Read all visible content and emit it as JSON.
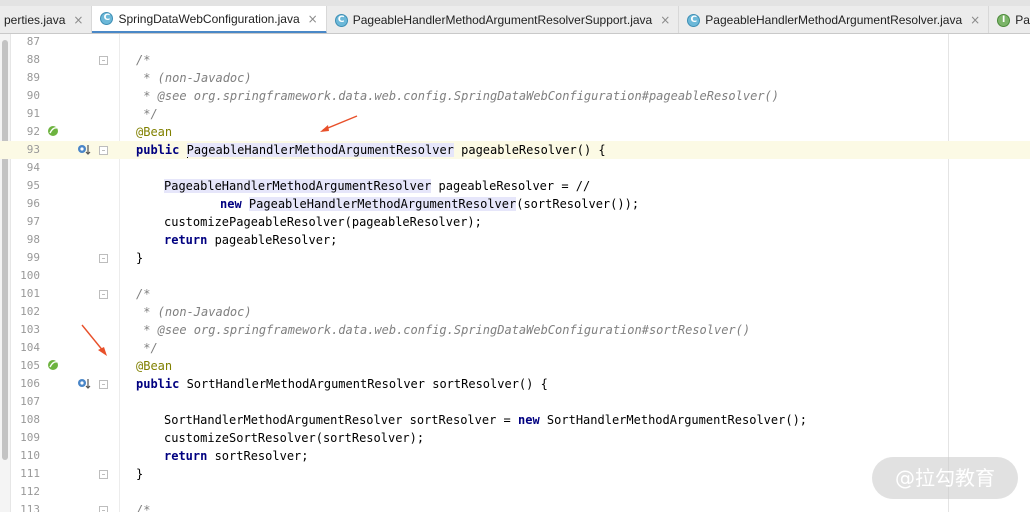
{
  "tabs": [
    {
      "label": "perties.java",
      "icon": "none",
      "active": false
    },
    {
      "label": "SpringDataWebConfiguration.java",
      "icon": "class-icon",
      "active": true
    },
    {
      "label": "PageableHandlerMethodArgumentResolverSupport.java",
      "icon": "class-icon",
      "active": false
    },
    {
      "label": "PageableHandlerMethodArgumentResolver.java",
      "icon": "class-icon",
      "active": false
    },
    {
      "label": "PageableArgument",
      "icon": "interface-icon",
      "active": false
    }
  ],
  "tab_icon_glyphs": {
    "class": "C",
    "interface": "I",
    "close": "×"
  },
  "line_numbers": [
    "87",
    "88",
    "89",
    "90",
    "91",
    "92",
    "93",
    "94",
    "95",
    "96",
    "97",
    "98",
    "99",
    "100",
    "101",
    "102",
    "103",
    "104",
    "105",
    "106",
    "107",
    "108",
    "109",
    "110",
    "111",
    "112",
    "113"
  ],
  "code": {
    "l88": "/*",
    "l89": " * (non-Javadoc)",
    "l90": " * @see org.springframework.data.web.config.SpringDataWebConfiguration#pageableResolver()",
    "l91": " */",
    "l92": "@Bean",
    "l93_kw": "public",
    "l93_type": "PageableHandlerMethodArgumentResolver",
    "l93_rest": " pageableResolver() {",
    "l95_type": "PageableHandlerMethodArgumentResolver",
    "l95_rest": " pageableResolver = //",
    "l96_kw": "new",
    "l96_type": "PageableHandlerMethodArgumentResolver",
    "l96_rest": "(sortResolver());",
    "l97": "customizePageableResolver(pageableResolver);",
    "l98_kw": "return",
    "l98_rest": " pageableResolver;",
    "l99": "}",
    "l101": "/*",
    "l102": " * (non-Javadoc)",
    "l103": " * @see org.springframework.data.web.config.SpringDataWebConfiguration#sortResolver()",
    "l104": " */",
    "l105": "@Bean",
    "l106_kw": "public",
    "l106_rest": " SortHandlerMethodArgumentResolver sortResolver() {",
    "l108_a": "SortHandlerMethodArgumentResolver sortResolver = ",
    "l108_kw": "new",
    "l108_b": " SortHandlerMethodArgumentResolver();",
    "l109": "customizeSortResolver(sortResolver);",
    "l110_kw": "return",
    "l110_rest": " sortResolver;",
    "l111": "}",
    "l113": "/*"
  },
  "watermark": "@拉勾教育",
  "colors": {
    "keyword": "#000080",
    "comment": "#808080",
    "annotation": "#808000",
    "highlight": "#e6e6fa",
    "current_line": "#fcfae5",
    "arrow": "#e8502a"
  }
}
